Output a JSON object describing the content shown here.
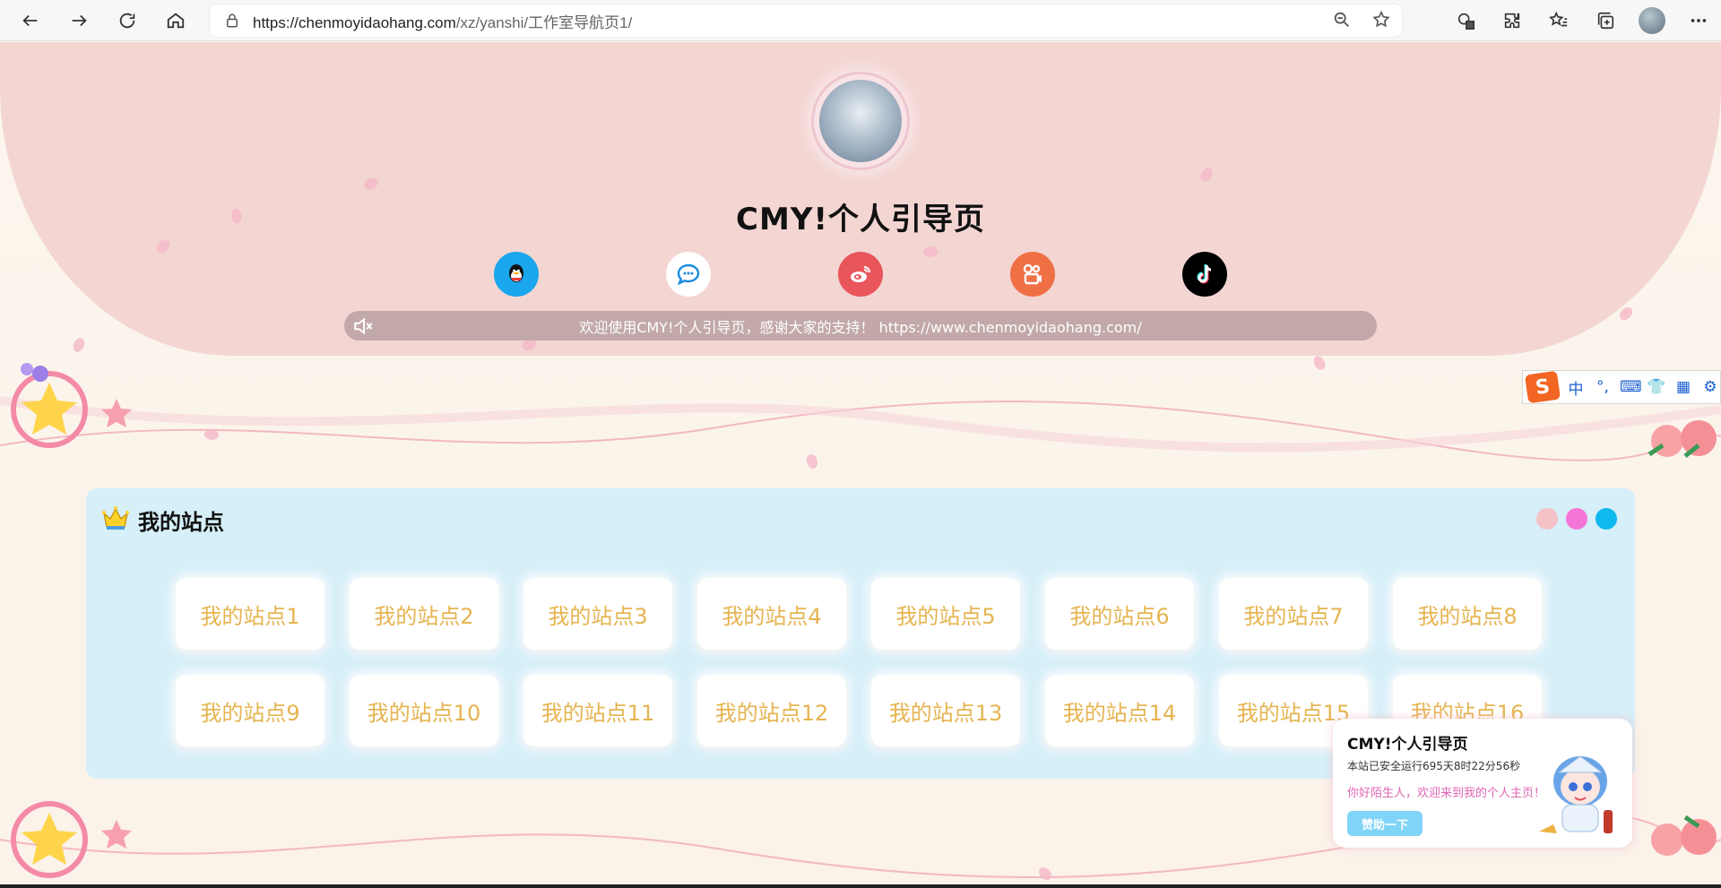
{
  "browser": {
    "url_host": "https://chenmoyidaohang.com",
    "url_path": "/xz/yanshi/工作室导航页1/"
  },
  "hero": {
    "title": "CMY!个人引导页",
    "notice": "欢迎使用CMY!个人引导页，感谢大家的支持！ https://www.chenmoyidaohang.com/",
    "socials": [
      {
        "name": "qq-icon",
        "color": "#1aa7ee"
      },
      {
        "name": "chat-bubble-icon",
        "color": "#ffffff"
      },
      {
        "name": "weibo-icon",
        "color": "#e8555a"
      },
      {
        "name": "kuaishou-icon",
        "color": "#f07046"
      },
      {
        "name": "tiktok-icon",
        "color": "#000000"
      }
    ]
  },
  "ime": {
    "logo": "S",
    "items": [
      "中",
      "°,",
      "⌨",
      "👕",
      "▦",
      "⚙"
    ]
  },
  "sites": {
    "title": "我的站点",
    "dot_colors": [
      "#f4c2c6",
      "#f575d6",
      "#0fb8ef"
    ],
    "items": [
      "我的站点1",
      "我的站点2",
      "我的站点3",
      "我的站点4",
      "我的站点5",
      "我的站点6",
      "我的站点7",
      "我的站点8",
      "我的站点9",
      "我的站点10",
      "我的站点11",
      "我的站点12",
      "我的站点13",
      "我的站点14",
      "我的站点15",
      "我的站点16"
    ]
  },
  "card": {
    "title": "CMY!个人引导页",
    "runtime": "本站已安全运行695天8时22分56秒",
    "greet": "你好陌生人，欢迎来到我的个人主页！",
    "button": "赞助一下"
  }
}
